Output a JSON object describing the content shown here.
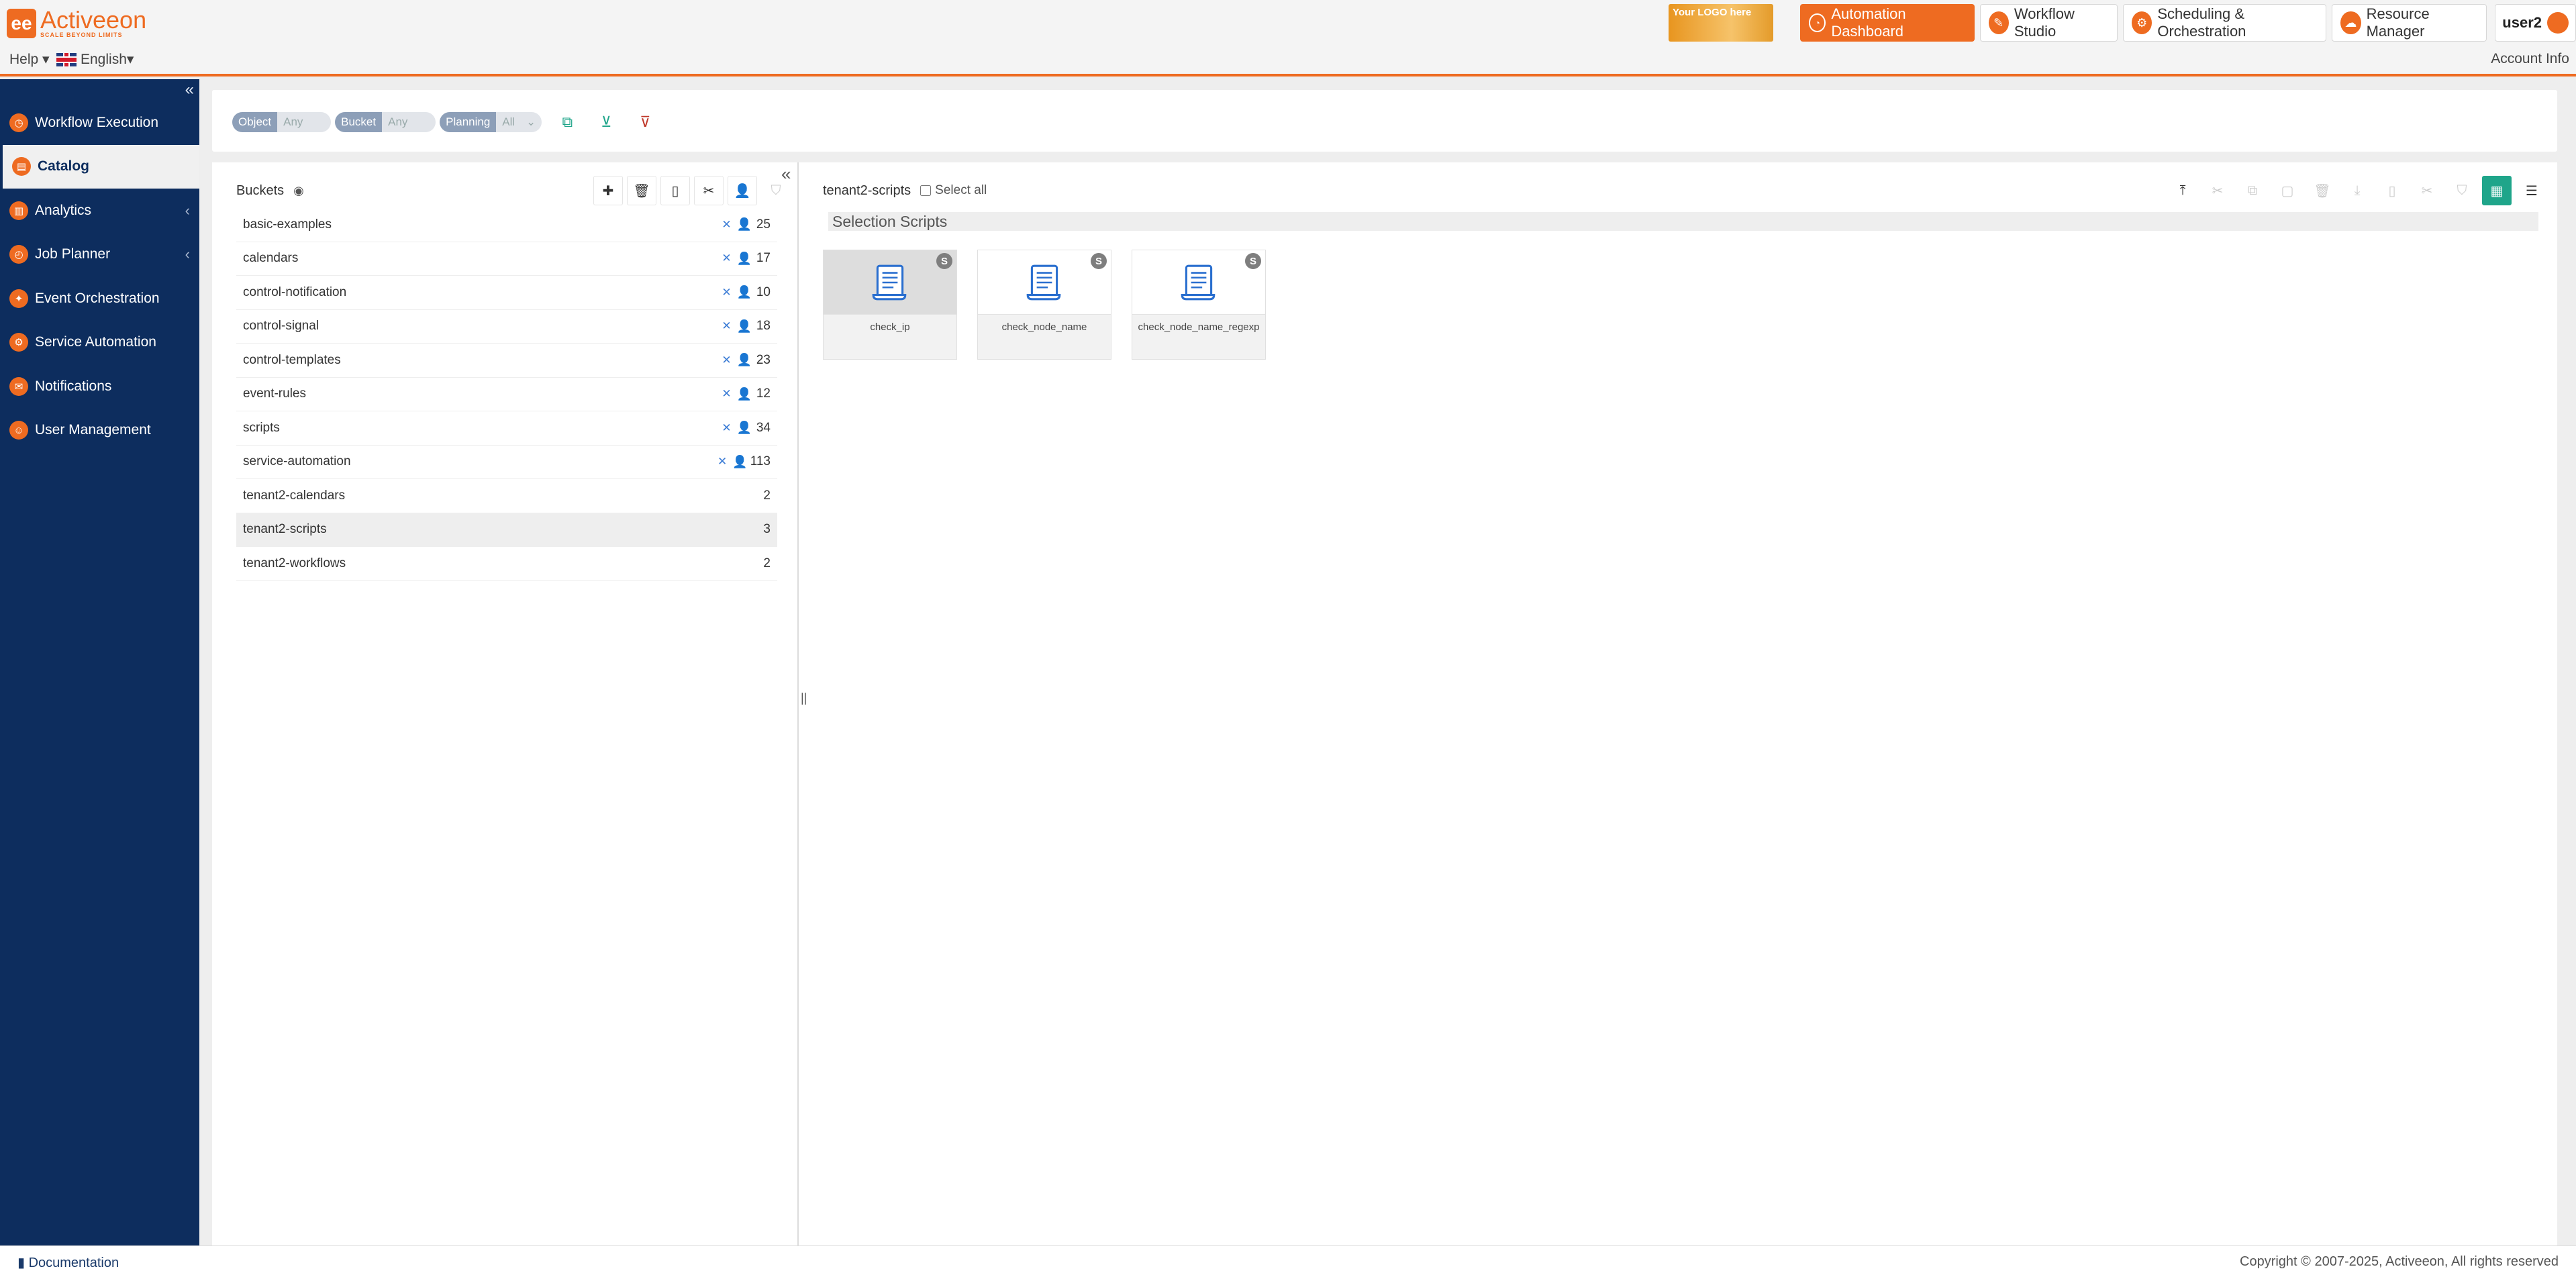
{
  "header": {
    "brand": "Activeeon",
    "brand_tag": "SCALE BEYOND LIMITS",
    "custom_logo": "Your LOGO here",
    "portals": [
      {
        "label": "Automation Dashboard",
        "active": true,
        "icon": "gauge-icon"
      },
      {
        "label": "Workflow Studio",
        "active": false,
        "icon": "studio-icon"
      },
      {
        "label": "Scheduling & Orchestration",
        "active": false,
        "icon": "scheduler-icon"
      },
      {
        "label": "Resource Manager",
        "active": false,
        "icon": "cloud-icon"
      }
    ],
    "user": "user2"
  },
  "subbar": {
    "help": "Help",
    "language": "English",
    "account": "Account Info"
  },
  "sidebar": {
    "items": [
      {
        "label": "Workflow Execution",
        "icon": "workflow-execution-icon",
        "chevron": false,
        "active": false
      },
      {
        "label": "Catalog",
        "icon": "catalog-icon",
        "chevron": false,
        "active": true
      },
      {
        "label": "Analytics",
        "icon": "analytics-icon",
        "chevron": true,
        "active": false
      },
      {
        "label": "Job Planner",
        "icon": "job-planner-icon",
        "chevron": true,
        "active": false
      },
      {
        "label": "Event Orchestration",
        "icon": "event-orchestration-icon",
        "chevron": false,
        "active": false
      },
      {
        "label": "Service Automation",
        "icon": "service-automation-icon",
        "chevron": false,
        "active": false
      },
      {
        "label": "Notifications",
        "icon": "notifications-icon",
        "chevron": false,
        "active": false
      },
      {
        "label": "User Management",
        "icon": "user-management-icon",
        "chevron": false,
        "active": false
      }
    ]
  },
  "filters": {
    "object": {
      "key": "Object",
      "value": "Any"
    },
    "bucket": {
      "key": "Bucket",
      "value": "Any"
    },
    "planning": {
      "key": "Planning",
      "value": "All"
    }
  },
  "buckets": {
    "title": "Buckets",
    "rows": [
      {
        "name": "basic-examples",
        "count": "25",
        "icons": true
      },
      {
        "name": "calendars",
        "count": "17",
        "icons": true
      },
      {
        "name": "control-notification",
        "count": "10",
        "icons": true
      },
      {
        "name": "control-signal",
        "count": "18",
        "icons": true
      },
      {
        "name": "control-templates",
        "count": "23",
        "icons": true
      },
      {
        "name": "event-rules",
        "count": "12",
        "icons": true
      },
      {
        "name": "scripts",
        "count": "34",
        "icons": true
      },
      {
        "name": "service-automation",
        "count": "113",
        "icons": true
      },
      {
        "name": "tenant2-calendars",
        "count": "2",
        "icons": false
      },
      {
        "name": "tenant2-scripts",
        "count": "3",
        "icons": false,
        "selected": true
      },
      {
        "name": "tenant2-workflows",
        "count": "2",
        "icons": false
      }
    ]
  },
  "objects": {
    "bucket_name": "tenant2-scripts",
    "select_all": "Select all",
    "section": "Selection Scripts",
    "items": [
      {
        "name": "check_ip",
        "badge": "S"
      },
      {
        "name": "check_node_name",
        "badge": "S"
      },
      {
        "name": "check_node_name_regexp",
        "badge": "S"
      }
    ]
  },
  "footer": {
    "docs": "Documentation",
    "copyright": "Copyright © 2007-2025, Activeeon, All rights reserved"
  },
  "colors": {
    "accent": "#ee6b21",
    "sidebar": "#0d2d5e",
    "teal": "#1fa58a"
  }
}
